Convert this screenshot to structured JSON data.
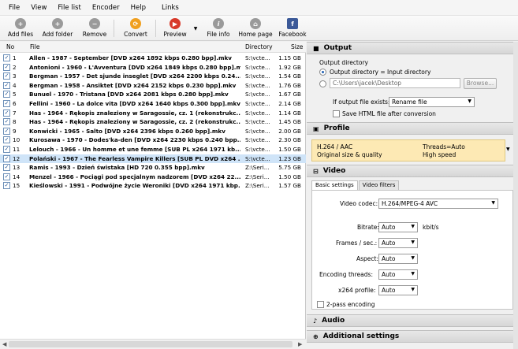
{
  "menu": [
    "File",
    "View",
    "File list",
    "Encoder",
    "Help",
    "Links"
  ],
  "toolbar": {
    "add_files": "Add files",
    "add_folder": "Add folder",
    "remove": "Remove",
    "convert": "Convert",
    "preview": "Preview",
    "file_info": "File info",
    "home_page": "Home page",
    "facebook": "Facebook"
  },
  "file_list": {
    "columns": [
      "No",
      "File",
      "Directory",
      "Size"
    ],
    "rows": [
      {
        "no": "1",
        "file": "Allen - 1987 - September [DVD x264 1892 kbps 0.280 bpp].mkv",
        "dir": "S:\\vcte...",
        "size": "1.15 GB"
      },
      {
        "no": "2",
        "file": "Antonioni - 1960 - L'Avventura [DVD x264 1849 kbps 0.280 bpp].mkv",
        "dir": "S:\\vcte...",
        "size": "1.92 GB"
      },
      {
        "no": "3",
        "file": "Bergman - 1957 - Det sjunde inseglet [DVD x264 2200 kbps 0.24...",
        "dir": "S:\\vcte...",
        "size": "1.54 GB"
      },
      {
        "no": "4",
        "file": "Bergman - 1958 - Ansiktet [DVD x264 2152 kbps 0.230 bpp].mkv",
        "dir": "S:\\vcte...",
        "size": "1.76 GB"
      },
      {
        "no": "5",
        "file": "Bunuel - 1970 - Tristana [DVD x264 2081 kbps 0.280 bpp].mkv",
        "dir": "S:\\vcte...",
        "size": "1.67 GB"
      },
      {
        "no": "6",
        "file": "Fellini - 1960 - La dolce vita [DVD x264 1640 kbps 0.300 bpp].mkv",
        "dir": "S:\\vcte...",
        "size": "2.14 GB"
      },
      {
        "no": "7",
        "file": "Has - 1964 - Rękopis znaleziony w Saragossie, cz. 1 (rekonstrukc...",
        "dir": "S:\\vcte...",
        "size": "1.14 GB"
      },
      {
        "no": "8",
        "file": "Has - 1964 - Rękopis znaleziony w Saragossie, cz. 2 (rekonstrukc...",
        "dir": "S:\\vcte...",
        "size": "1.45 GB"
      },
      {
        "no": "9",
        "file": "Konwicki - 1965 - Salto [DVD x264 2396 kbps 0.260 bpp].mkv",
        "dir": "S:\\vcte...",
        "size": "2.00 GB"
      },
      {
        "no": "10",
        "file": "Kurosawa - 1970 - Dodes'ka-den [DVD x264 2230 kbps 0.240 bpp...",
        "dir": "S:\\vcte...",
        "size": "2.30 GB"
      },
      {
        "no": "11",
        "file": "Lelouch - 1966 - Un homme et une femme [SUB PL x264 1971 kb...",
        "dir": "S:\\vcte...",
        "size": "1.50 GB"
      },
      {
        "no": "12",
        "file": "Polański - 1967 - The Fearless Vampire Killers [SUB PL DVD x264 ...",
        "dir": "S:\\vcte...",
        "size": "1.23 GB",
        "selected": true
      },
      {
        "no": "13",
        "file": "Ramis - 1993 - Dzień świstaka [HD 720 0.355 bpp].mkv",
        "dir": "Z:\\Seri...",
        "size": "5.75 GB"
      },
      {
        "no": "14",
        "file": "Menzel - 1966 - Pociągi pod specjalnym nadzorem [DVD x264 22...",
        "dir": "Z:\\Seri...",
        "size": "1.50 GB"
      },
      {
        "no": "15",
        "file": "Kieślowski - 1991 - Podwójne życie Weroniki [DVD x264 1971 kbp...",
        "dir": "Z:\\Seri...",
        "size": "1.57 GB"
      }
    ]
  },
  "output": {
    "header": "Output",
    "dir_label": "Output directory",
    "radio_same": "Output directory = Input directory",
    "path_value": "C:\\Users\\jacek\\Desktop",
    "browse": "Browse...",
    "exists_label": "If output file exists:",
    "exists_value": "Rename file",
    "save_html": "Save HTML file after conversion"
  },
  "profile": {
    "header": "Profile",
    "line1_left": "H.264 / AAC",
    "line1_right": "Threads=Auto",
    "line2_left": "Original size & quality",
    "line2_right": "High speed"
  },
  "video": {
    "header": "Video",
    "tab_basic": "Basic settings",
    "tab_filters": "Video filters",
    "codec_label": "Video codec:",
    "codec_value": "H.264/MPEG-4 AVC",
    "bitrate_label": "Bitrate:",
    "bitrate_value": "Auto",
    "bitrate_unit": "kbit/s",
    "fps_label": "Frames / sec.:",
    "fps_value": "Auto",
    "aspect_label": "Aspect:",
    "aspect_value": "Auto",
    "threads_label": "Encoding threads:",
    "threads_value": "Auto",
    "profile_label": "x264 profile:",
    "profile_value": "Auto",
    "twopass": "2-pass encoding"
  },
  "audio": {
    "header": "Audio"
  },
  "additional": {
    "header": "Additional settings"
  }
}
